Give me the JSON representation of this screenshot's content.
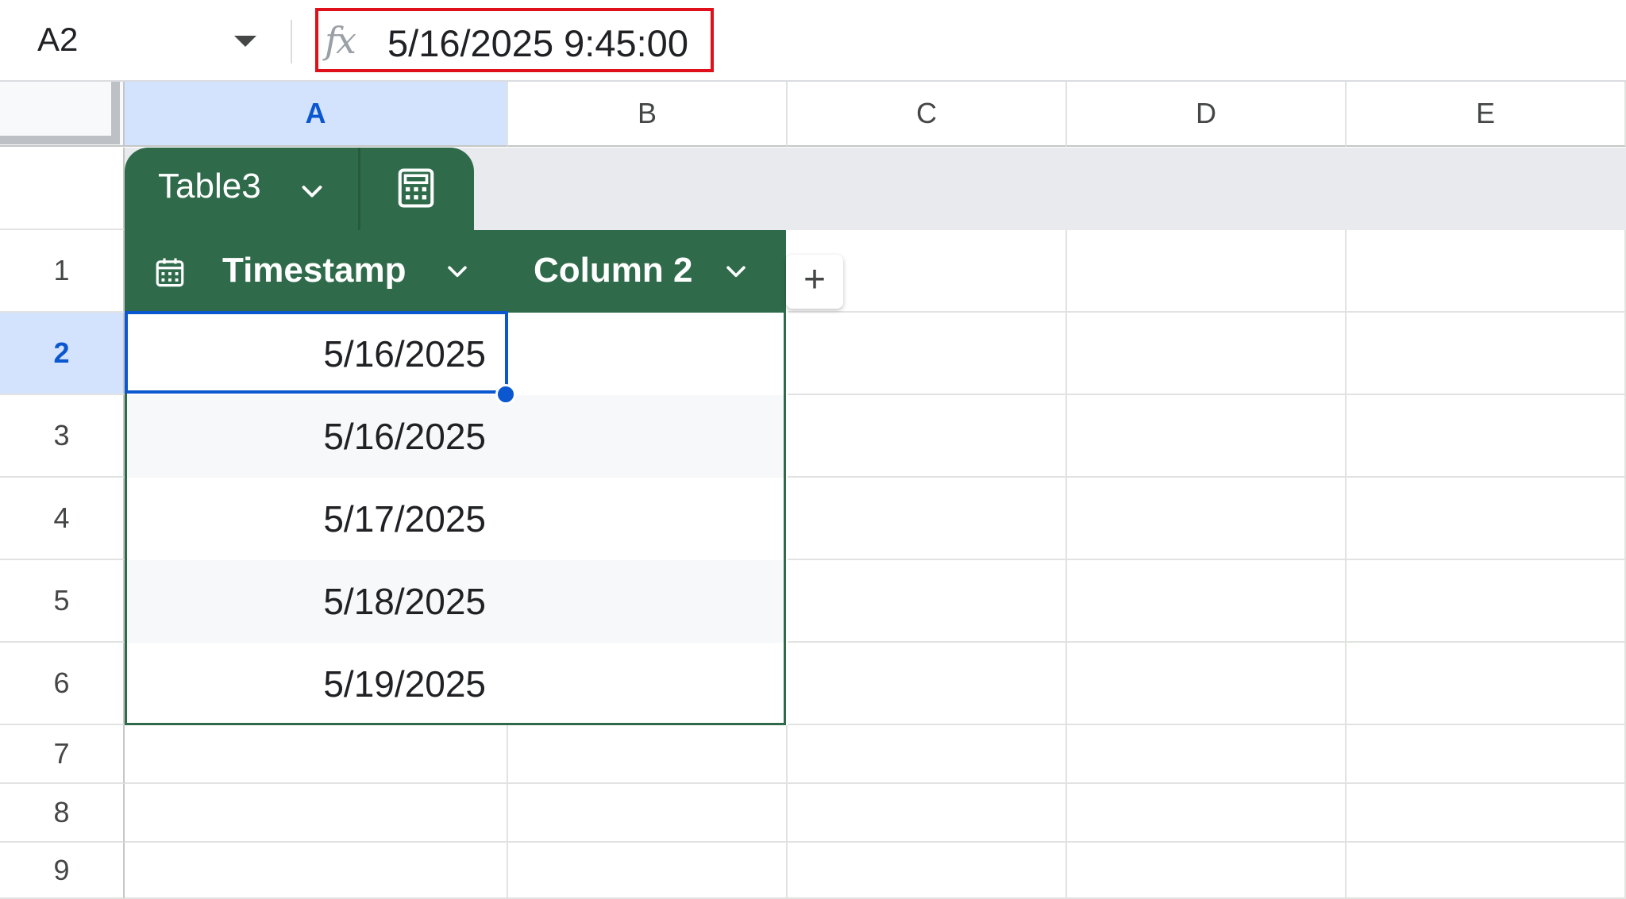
{
  "name_box": {
    "value": "A2"
  },
  "formula_bar": {
    "fx_label": "fx",
    "value": "5/16/2025 9:45:00"
  },
  "columns": [
    "A",
    "B",
    "C",
    "D",
    "E"
  ],
  "selected_column": "A",
  "rows": [
    "1",
    "2",
    "3",
    "4",
    "5",
    "6",
    "7",
    "8",
    "9"
  ],
  "selected_row": "2",
  "table": {
    "name": "Table3",
    "headers": [
      {
        "label": "Timestamp",
        "type_icon": "calendar-icon"
      },
      {
        "label": "Column 2",
        "type_icon": ""
      }
    ],
    "rows": [
      {
        "timestamp": "5/16/2025",
        "column2": ""
      },
      {
        "timestamp": "5/16/2025",
        "column2": ""
      },
      {
        "timestamp": "5/17/2025",
        "column2": ""
      },
      {
        "timestamp": "5/18/2025",
        "column2": ""
      },
      {
        "timestamp": "5/19/2025",
        "column2": ""
      }
    ]
  },
  "add_column_label": "+",
  "colors": {
    "table_green": "#2f6b4a",
    "selection_blue": "#0b57d0",
    "formula_highlight": "#e0101a"
  }
}
